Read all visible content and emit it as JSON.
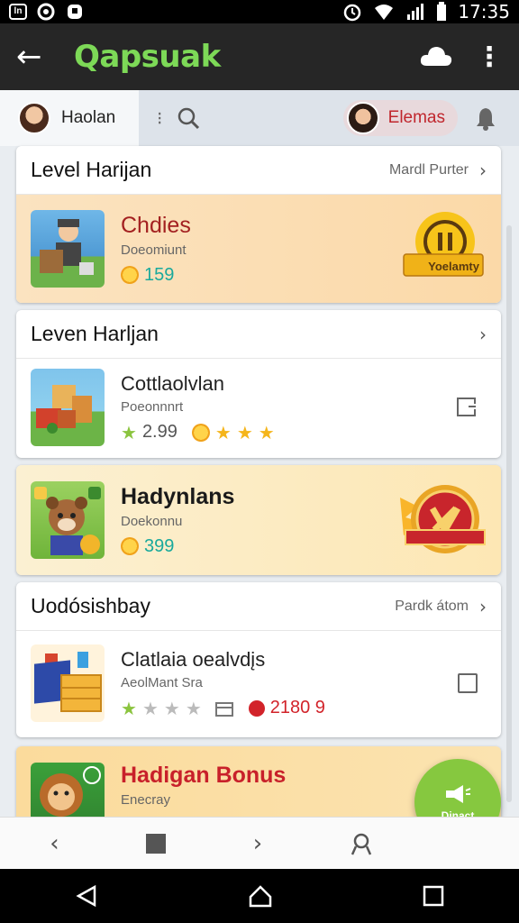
{
  "status_bar": {
    "time": "17:35",
    "left_icons": [
      "ln-icon",
      "circle-icon",
      "shield-icon"
    ]
  },
  "app_bar": {
    "title": "Qapsuak"
  },
  "user_row": {
    "user_name": "Haolan",
    "other_user_name": "Elemas"
  },
  "section1": {
    "title": "Level Harijan",
    "more_label": "Mardl Purter",
    "item": {
      "title": "Chdies",
      "subtitle": "Doeomiunt",
      "coins": "159",
      "badge_label": "Yoelamty"
    }
  },
  "section2": {
    "title": "Leven Harljan",
    "item": {
      "title": "Cottlaolvlan",
      "subtitle": "Poeonnnrt",
      "rating": "2.99",
      "stars": 3
    }
  },
  "section3": {
    "item": {
      "title": "Hadynlans",
      "subtitle": "Doekonnu",
      "coins": "399"
    }
  },
  "section4": {
    "title": "Uodósishbay",
    "more_label": "Pardk átom",
    "item": {
      "title": "Clatlaia oealvdįs",
      "subtitle": "AeolMant Sra",
      "count": "2180 9"
    }
  },
  "section5": {
    "item": {
      "title": "Hadigan Bonus",
      "subtitle": "Enecray"
    }
  },
  "fab": {
    "label": "Dinact"
  },
  "colors": {
    "accent_green": "#7dd957",
    "red": "#d2232a",
    "teal": "#19a99c",
    "orange_card": "#fbdcb0"
  }
}
